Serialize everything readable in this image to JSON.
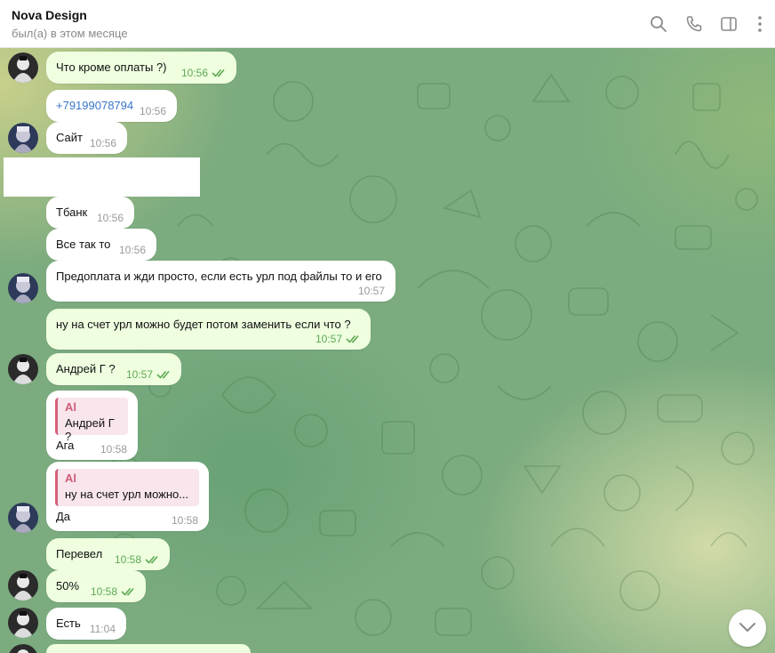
{
  "header": {
    "contact_name": "Nova Design",
    "status": "был(а) в этом месяце",
    "icons": [
      "search-icon",
      "phone-icon",
      "sidebar-toggle-icon",
      "more-vertical-icon"
    ]
  },
  "messages": [
    {
      "text": "Что кроме оплаты ?)",
      "time": "10:56",
      "outgoing": true,
      "read": true
    },
    {
      "text": "+79199078794",
      "time": "10:56",
      "outgoing": false,
      "is_link": true
    },
    {
      "text": "Сайт",
      "time": "10:56",
      "outgoing": false
    },
    {
      "text": "Тбанк",
      "time": "10:56",
      "outgoing": false
    },
    {
      "text": "Все так то",
      "time": "10:56",
      "outgoing": false
    },
    {
      "text": "Предоплата и жди просто, если есть урл под файлы то и его",
      "time": "10:57",
      "outgoing": false
    },
    {
      "text": "ну на счет урл можно будет потом заменить если что ?",
      "time": "10:57",
      "outgoing": true,
      "read": true
    },
    {
      "text": "Андрей Г ?",
      "time": "10:57",
      "outgoing": true,
      "read": true
    },
    {
      "reply_to_name": "Al",
      "reply_to_text": "Андрей Г ?",
      "text": "Ага",
      "time": "10:58",
      "outgoing": false
    },
    {
      "reply_to_name": "Al",
      "reply_to_text": "ну на счет урл можно...",
      "text": "Да",
      "time": "10:58",
      "outgoing": false
    },
    {
      "text": "Перевел",
      "time": "10:58",
      "outgoing": true,
      "read": true
    },
    {
      "text": "50%",
      "time": "10:58",
      "outgoing": true,
      "read": true
    },
    {
      "text": "Есть",
      "time": "11:04",
      "outgoing": false
    }
  ],
  "colors": {
    "outgoing_bubble": "#eefedf",
    "incoming_bubble": "#ffffff",
    "outgoing_time": "#5ea953",
    "reply_accent": "#d6607a",
    "link": "#3a76c8"
  }
}
